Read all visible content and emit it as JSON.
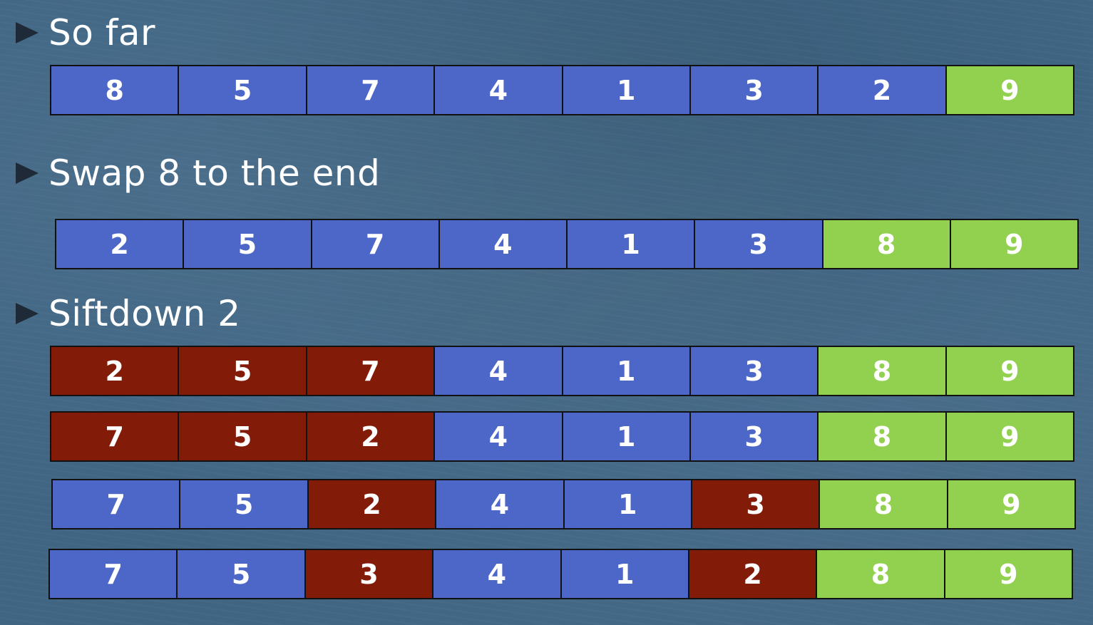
{
  "colors": {
    "blue": "#4d67c9",
    "red": "#821b08",
    "green": "#92d050"
  },
  "bullets": [
    {
      "text": "So far",
      "icon": "triangle-bullet-icon"
    },
    {
      "text": "Swap 8 to the end",
      "icon": "triangle-bullet-icon"
    },
    {
      "text": "Siftdown 2",
      "icon": "triangle-bullet-icon"
    }
  ],
  "arrays": [
    {
      "step": "so-far",
      "cells": [
        {
          "value": "8",
          "color": "blue"
        },
        {
          "value": "5",
          "color": "blue"
        },
        {
          "value": "7",
          "color": "blue"
        },
        {
          "value": "4",
          "color": "blue"
        },
        {
          "value": "1",
          "color": "blue"
        },
        {
          "value": "3",
          "color": "blue"
        },
        {
          "value": "2",
          "color": "blue"
        },
        {
          "value": "9",
          "color": "green"
        }
      ]
    },
    {
      "step": "swap",
      "cells": [
        {
          "value": "2",
          "color": "blue"
        },
        {
          "value": "5",
          "color": "blue"
        },
        {
          "value": "7",
          "color": "blue"
        },
        {
          "value": "4",
          "color": "blue"
        },
        {
          "value": "1",
          "color": "blue"
        },
        {
          "value": "3",
          "color": "blue"
        },
        {
          "value": "8",
          "color": "green"
        },
        {
          "value": "9",
          "color": "green"
        }
      ]
    },
    {
      "step": "siftdown-1",
      "cells": [
        {
          "value": "2",
          "color": "red"
        },
        {
          "value": "5",
          "color": "red"
        },
        {
          "value": "7",
          "color": "red"
        },
        {
          "value": "4",
          "color": "blue"
        },
        {
          "value": "1",
          "color": "blue"
        },
        {
          "value": "3",
          "color": "blue"
        },
        {
          "value": "8",
          "color": "green"
        },
        {
          "value": "9",
          "color": "green"
        }
      ]
    },
    {
      "step": "siftdown-2",
      "cells": [
        {
          "value": "7",
          "color": "red"
        },
        {
          "value": "5",
          "color": "red"
        },
        {
          "value": "2",
          "color": "red"
        },
        {
          "value": "4",
          "color": "blue"
        },
        {
          "value": "1",
          "color": "blue"
        },
        {
          "value": "3",
          "color": "blue"
        },
        {
          "value": "8",
          "color": "green"
        },
        {
          "value": "9",
          "color": "green"
        }
      ]
    },
    {
      "step": "siftdown-3",
      "cells": [
        {
          "value": "7",
          "color": "blue"
        },
        {
          "value": "5",
          "color": "blue"
        },
        {
          "value": "2",
          "color": "red"
        },
        {
          "value": "4",
          "color": "blue"
        },
        {
          "value": "1",
          "color": "blue"
        },
        {
          "value": "3",
          "color": "red"
        },
        {
          "value": "8",
          "color": "green"
        },
        {
          "value": "9",
          "color": "green"
        }
      ]
    },
    {
      "step": "siftdown-4",
      "cells": [
        {
          "value": "7",
          "color": "blue"
        },
        {
          "value": "5",
          "color": "blue"
        },
        {
          "value": "3",
          "color": "red"
        },
        {
          "value": "4",
          "color": "blue"
        },
        {
          "value": "1",
          "color": "blue"
        },
        {
          "value": "2",
          "color": "red"
        },
        {
          "value": "8",
          "color": "green"
        },
        {
          "value": "9",
          "color": "green"
        }
      ]
    }
  ]
}
